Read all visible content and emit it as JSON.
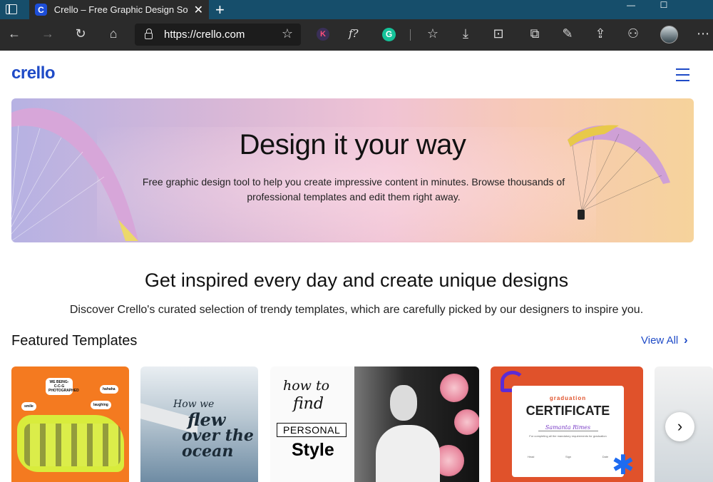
{
  "browser": {
    "tab_title": "Crello – Free Graphic Design Software",
    "tab_favicon_letter": "C",
    "url": "https://crello.com",
    "ext_k": "K",
    "ext_f": "f?",
    "ext_g": "G"
  },
  "site": {
    "logo": "crello",
    "brand_color": "#1f4bc7"
  },
  "hero": {
    "title": "Design it your way",
    "subtitle": "Free graphic design tool to help you create impressive content in minutes. Browse thousands of professional templates and edit them right away."
  },
  "section": {
    "heading": "Get inspired every day and create unique designs",
    "subheading": "Discover Crello's curated selection of trendy templates, which are carefully picked by our designers to inspire you."
  },
  "featured": {
    "title": "Featured Templates",
    "view_all": "View All",
    "cards": [
      {
        "bubbles": [
          "WE BEING-C-C-G PHOTOGRAPHED",
          "hahaha",
          "laughing",
          "smile"
        ]
      },
      {
        "lines": [
          "How we",
          "flew",
          "over the ocean"
        ]
      },
      {
        "lines": [
          "how to",
          "find",
          "PERSONAL",
          "Style"
        ]
      },
      {
        "eyebrow": "graduation",
        "title": "CERTIFICATE",
        "name": "Samanta Rimes",
        "small": "For completing all the mandatory requirements for graduation",
        "sigs": [
          "Head",
          "Sign",
          "Date"
        ]
      }
    ]
  }
}
